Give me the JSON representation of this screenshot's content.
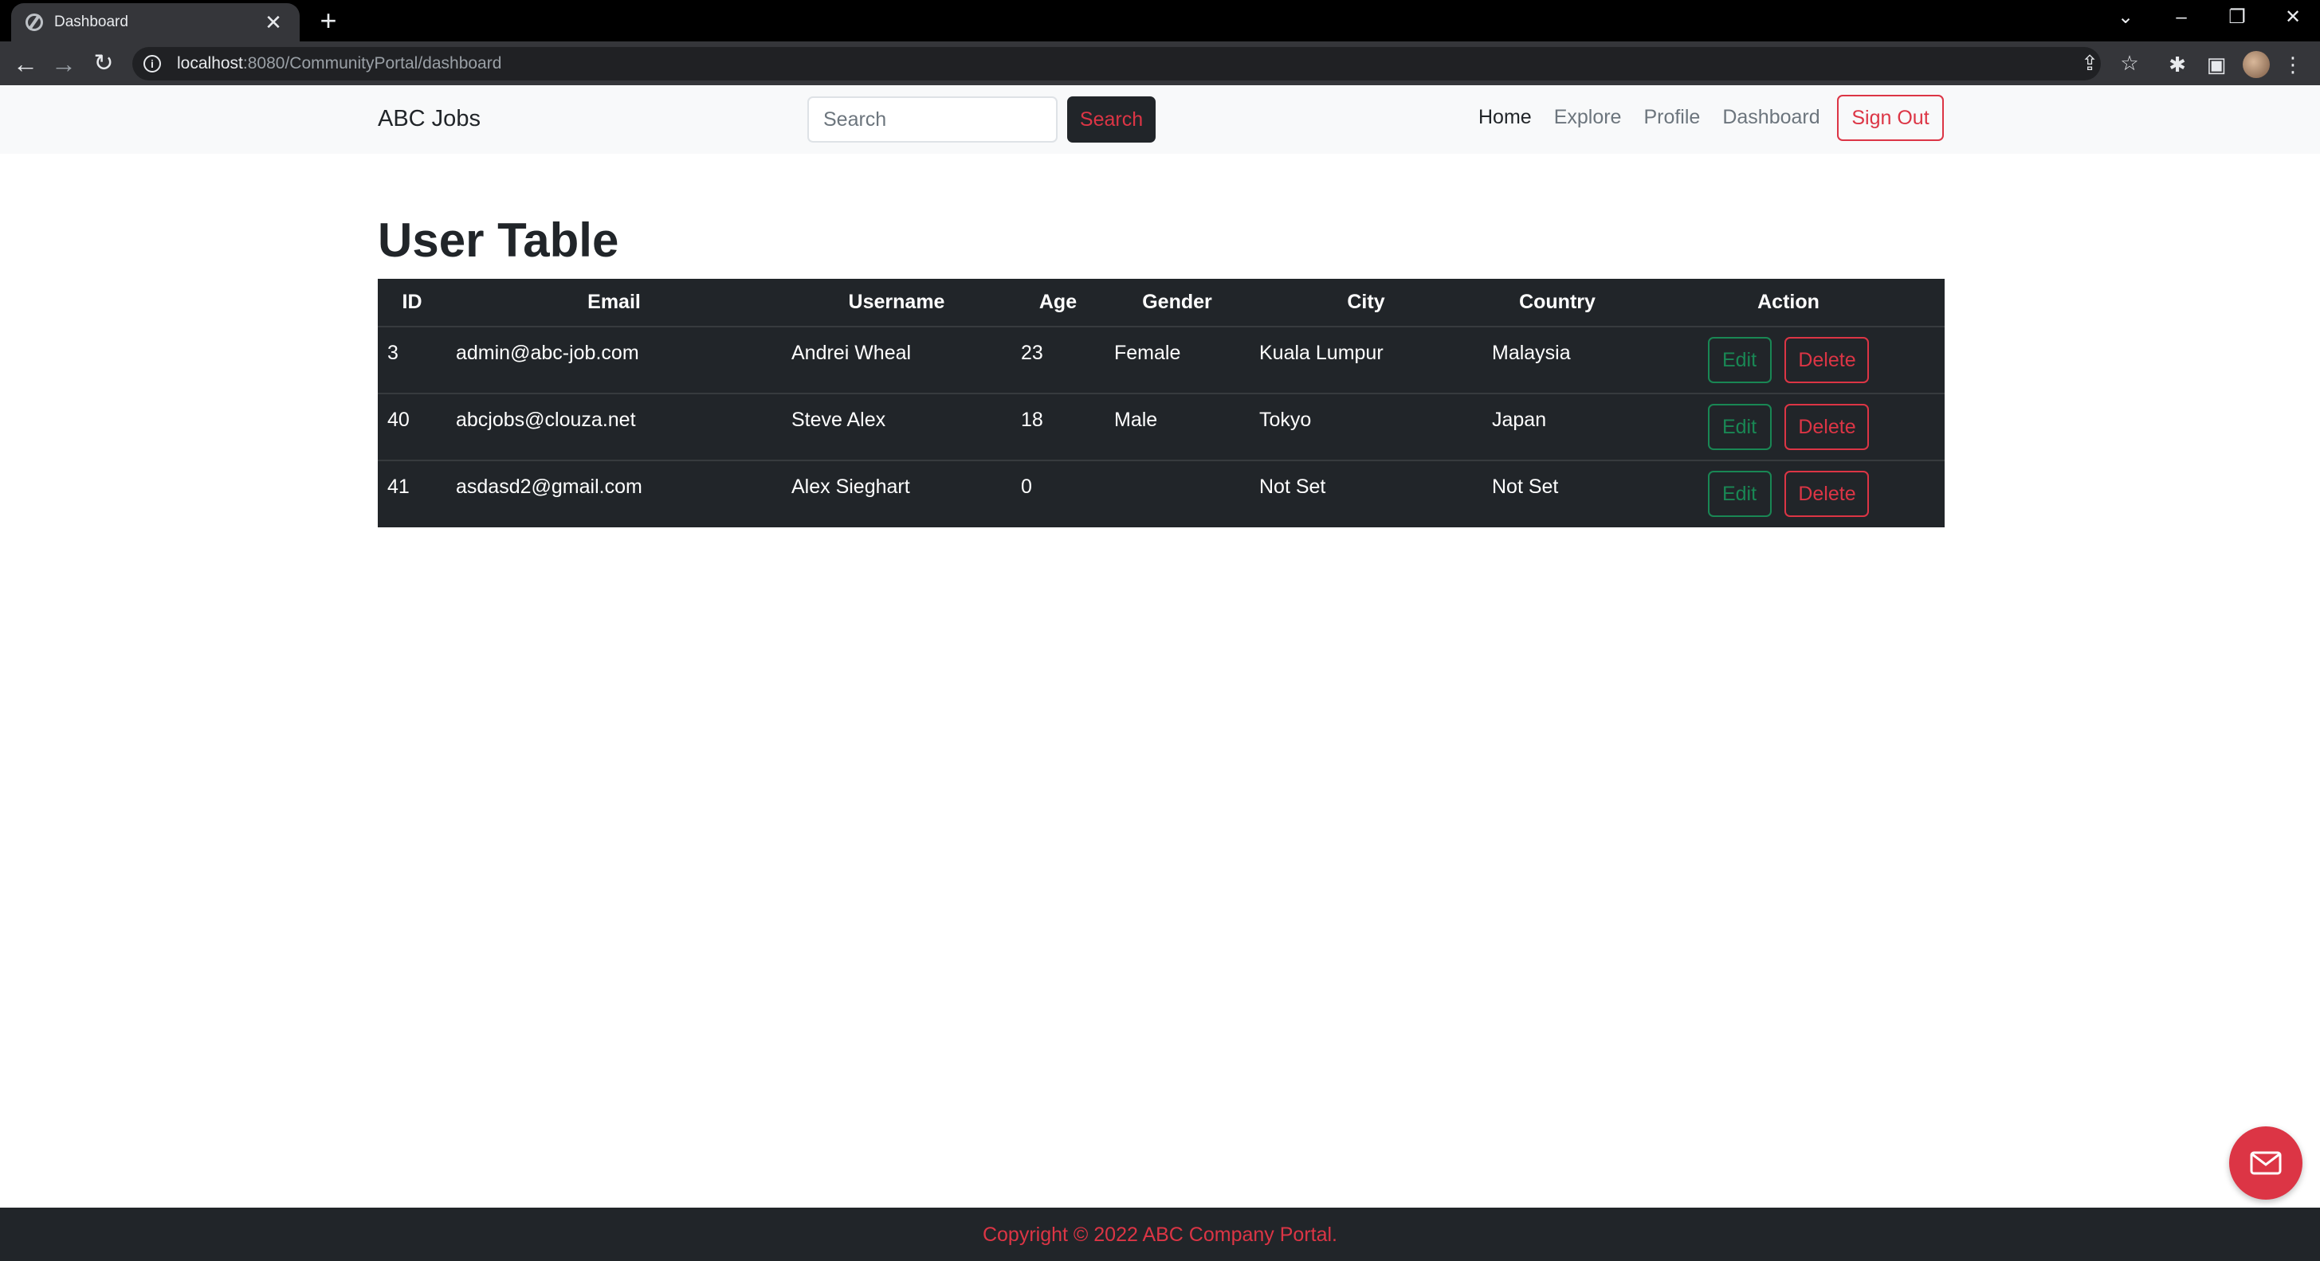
{
  "browser": {
    "tab_title": "Dashboard",
    "tab_close": "✕",
    "new_tab": "+",
    "url_host": "localhost",
    "url_rest": ":8080/CommunityPortal/dashboard",
    "icons": [
      "globe-icon",
      "close-icon",
      "plus-icon",
      "chevron-down-icon",
      "minimize-icon",
      "restore-icon",
      "window-close-icon",
      "back-icon",
      "forward-icon",
      "reload-icon",
      "info-icon",
      "share-icon",
      "star-icon",
      "extensions-icon",
      "sidepanel-icon",
      "avatar",
      "menu-icon"
    ]
  },
  "navbar": {
    "brand": "ABC Jobs",
    "search_placeholder": "Search",
    "search_button": "Search",
    "links": [
      "Home",
      "Explore",
      "Profile",
      "Dashboard"
    ],
    "active_link": "Home",
    "sign_out": "Sign Out"
  },
  "main": {
    "title": "User Table",
    "table": {
      "headers": [
        "ID",
        "Email",
        "Username",
        "Age",
        "Gender",
        "City",
        "Country",
        "Action"
      ],
      "rows": [
        {
          "id": "3",
          "email": "admin@abc-job.com",
          "username": "Andrei Wheal",
          "age": "23",
          "gender": "Female",
          "city": "Kuala Lumpur",
          "country": "Malaysia"
        },
        {
          "id": "40",
          "email": "abcjobs@clouza.net",
          "username": "Steve Alex",
          "age": "18",
          "gender": "Male",
          "city": "Tokyo",
          "country": "Japan"
        },
        {
          "id": "41",
          "email": "asdasd2@gmail.com",
          "username": "Alex Sieghart",
          "age": "0",
          "gender": "",
          "city": "Not Set",
          "country": "Not Set"
        }
      ],
      "edit_label": "Edit",
      "delete_label": "Delete"
    }
  },
  "footer": {
    "copyright": "Copyright © 2022 ABC Company Portal."
  },
  "colors": {
    "danger": "#dc3545",
    "success": "#198754",
    "dark": "#212529",
    "light": "#f8f9fa"
  }
}
